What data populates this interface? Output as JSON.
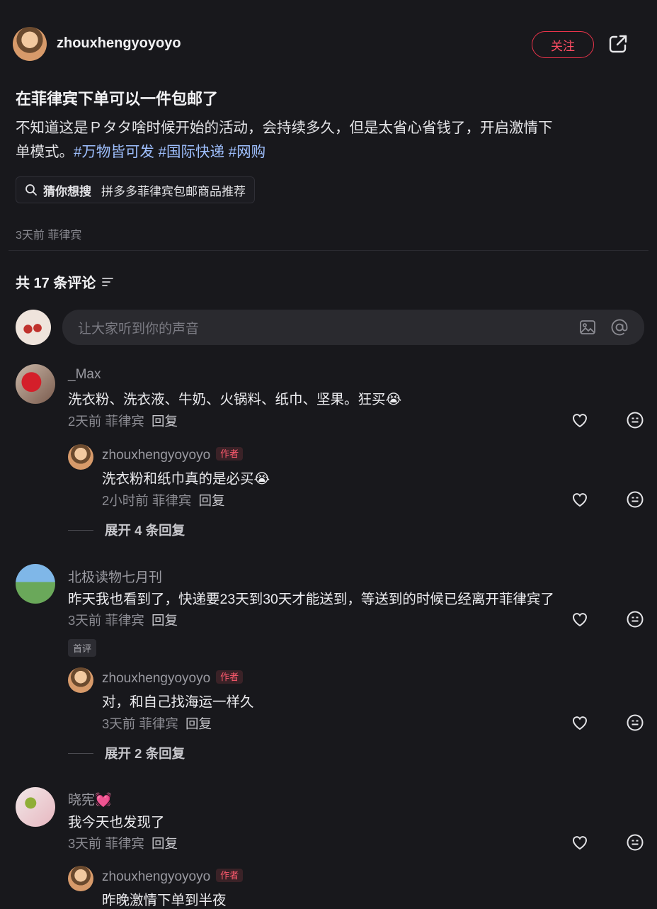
{
  "post": {
    "username": "zhouxhengyoyoyo",
    "follow_label": "关注",
    "title": "在菲律宾下单可以一件包邮了",
    "desc_line1": "不知道这是Ｐタタ啥时候开始的活动，会持续多久，但是太省心省钱了，开启激情下",
    "desc_line2_prefix": "单模式。",
    "tags": [
      "#万物皆可发",
      "#国际快递",
      "#网购"
    ],
    "suggest_label": "猜你想搜",
    "suggest_query": "拼多多菲律宾包邮商品推荐",
    "meta": "3天前  菲律宾"
  },
  "comments_header": {
    "count_label": "共 17 条评论"
  },
  "comment_input": {
    "placeholder": "让大家听到你的声音"
  },
  "comments": [
    {
      "name": "_Max",
      "text": "洗衣粉、洗衣液、牛奶、火锅料、纸巾、坚果。狂买",
      "emoji": "😭",
      "meta": "2天前  菲律宾",
      "reply_label": "回复",
      "reply": {
        "name": "zhouxhengyoyoyo",
        "badge": "作者",
        "text": "洗衣粉和纸巾真的是必买",
        "emoji": "😭",
        "meta": "2小时前  菲律宾",
        "reply_label": "回复"
      },
      "expand": "展开 4 条回复"
    },
    {
      "name": "北极读物七月刊",
      "text": "昨天我也看到了，快递要23天到30天才能送到，等送到的时候已经离开菲律宾了",
      "meta": "3天前  菲律宾",
      "reply_label": "回复",
      "first_badge": "首评",
      "reply": {
        "name": "zhouxhengyoyoyo",
        "badge": "作者",
        "text": "对，和自己找海运一样久",
        "meta": "3天前  菲律宾",
        "reply_label": "回复"
      },
      "expand": "展开 2 条回复"
    },
    {
      "name": "晓宪",
      "name_emoji": "💓",
      "text": "我今天也发现了",
      "meta": "3天前  菲律宾",
      "reply_label": "回复",
      "reply": {
        "name": "zhouxhengyoyoyo",
        "badge": "作者",
        "text": "昨晚激情下单到半夜"
      }
    }
  ]
}
